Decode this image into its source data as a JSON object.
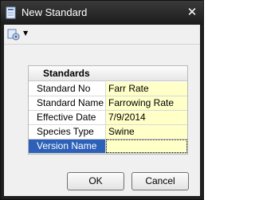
{
  "window": {
    "title": "New Standard",
    "close_glyph": "✕"
  },
  "toolbar": {
    "settings_icon": "gear-icon",
    "dropdown_glyph": "▼"
  },
  "grid": {
    "header": "Standards",
    "rows": [
      {
        "label": "Standard No",
        "value": "Farr Rate"
      },
      {
        "label": "Standard Name",
        "value": "Farrowing Rate"
      },
      {
        "label": "Effective Date",
        "value": "7/9/2014"
      },
      {
        "label": "Species Type",
        "value": "Swine"
      },
      {
        "label": "Version Name",
        "value": ""
      }
    ],
    "selected_row": 4
  },
  "buttons": {
    "ok": "OK",
    "cancel": "Cancel"
  },
  "colors": {
    "title_bar": "#1f1f1f",
    "selection": "#2d61b8",
    "value_cell": "#ffffc8"
  }
}
